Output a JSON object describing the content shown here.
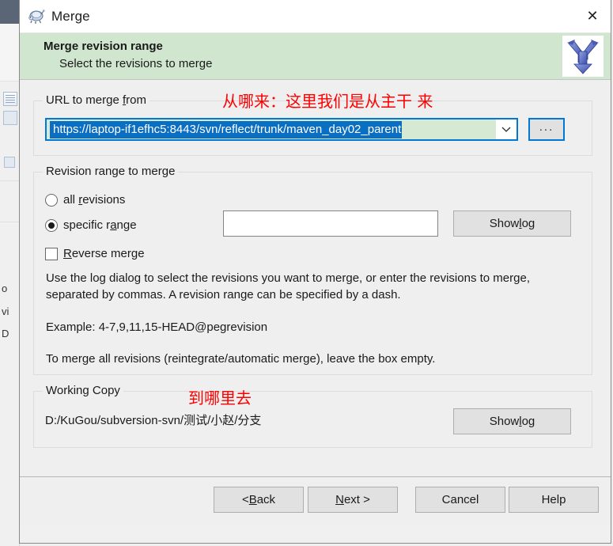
{
  "window": {
    "title": "Merge",
    "icon": "tortoisesvn-turtle-icon",
    "close_label": "✕"
  },
  "banner": {
    "title": "Merge revision range",
    "subtitle": "Select the revisions to merge",
    "icon": "merge-arrow-icon"
  },
  "url_group": {
    "label": "URL to merge from",
    "label_mnemonic": "f",
    "value": "https://laptop-if1efhc5:8443/svn/reflect/trunk/maven_day02_parent",
    "selected": true,
    "dropdown_icon": "chevron-down-icon",
    "browse_label": "...",
    "browse_focused": true
  },
  "revision_group": {
    "label": "Revision range to merge",
    "all_revisions_label": "all revisions",
    "all_revisions_mnemonic": "r",
    "all_revisions_checked": false,
    "specific_range_label": "specific range",
    "specific_range_mnemonic": "a",
    "specific_range_checked": true,
    "reverse_merge_label": "Reverse merge",
    "reverse_merge_mnemonic": "R",
    "reverse_merge_checked": false,
    "range_input_value": "",
    "show_log_label": "Show log",
    "show_log_mnemonic": "l",
    "help_line_1": "Use the log dialog to select the revisions you want to merge, or enter the revisions to merge, separated by commas. A revision range can be specified by a dash.",
    "help_line_2": "Example: 4-7,9,11,15-HEAD@pegrevision",
    "help_line_3": "To merge all revisions (reintegrate/automatic merge), leave the box empty."
  },
  "working_copy_group": {
    "label": "Working Copy",
    "path": "D:/KuGou/subversion-svn/测试/小赵/分支",
    "show_log_label": "Show log",
    "show_log_mnemonic": "l"
  },
  "footer": {
    "back_label": "< Back",
    "back_mnemonic": "B",
    "next_label": "Next >",
    "next_mnemonic": "N",
    "cancel_label": "Cancel",
    "help_label": "Help"
  },
  "annotations": {
    "from_text": "从哪来：这里我们是从主干 来",
    "to_text": "到哪里去",
    "color": "#fe0000"
  }
}
